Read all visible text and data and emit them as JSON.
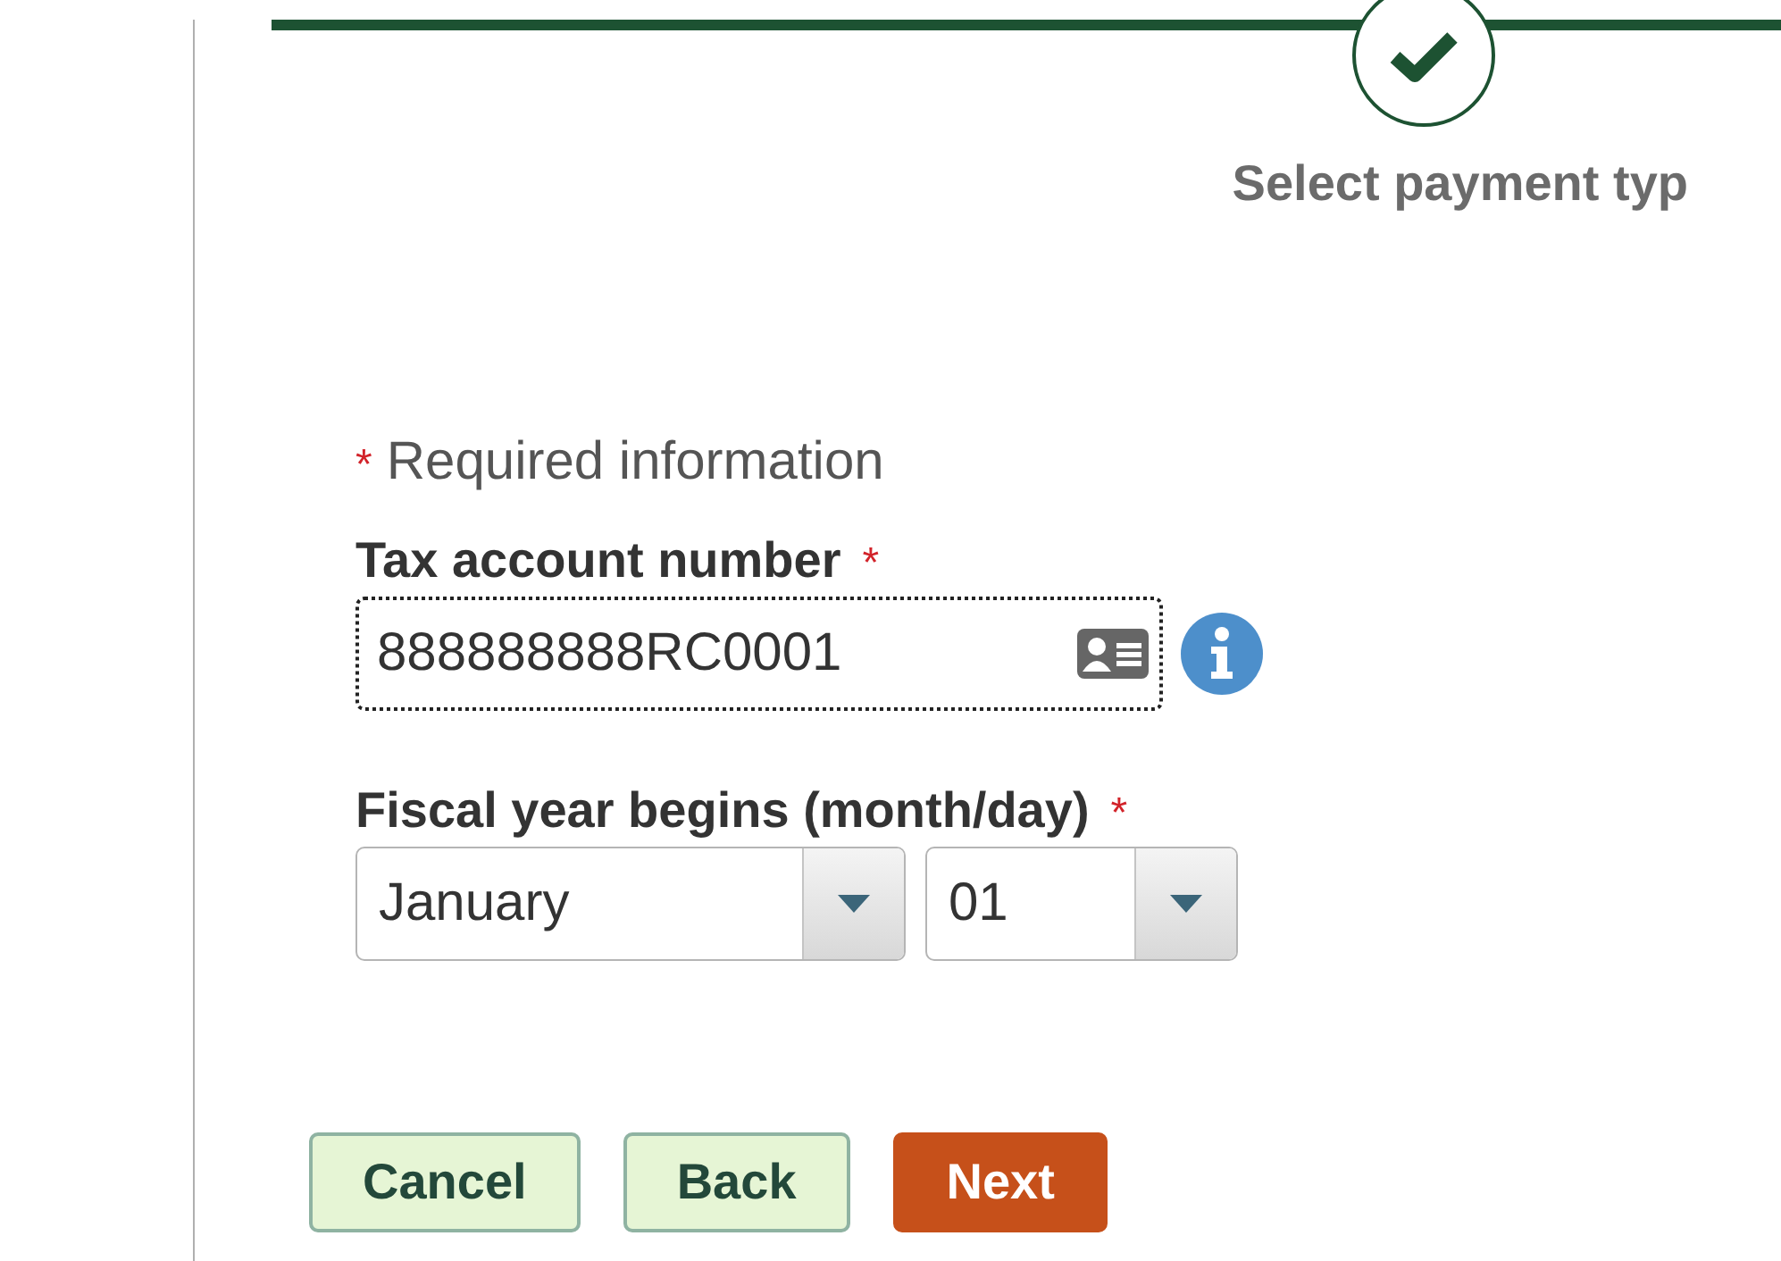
{
  "progress": {
    "step_label": "Select payment typ",
    "completed": true
  },
  "required_note": {
    "marker": "*",
    "text": "Required information"
  },
  "tax_account": {
    "label": "Tax account number",
    "required": true,
    "value": "888888888RC0001"
  },
  "fiscal_year": {
    "label": "Fiscal year begins (month/day)",
    "required": true,
    "month": "January",
    "day": "01"
  },
  "buttons": [
    {
      "label": "Cancel",
      "kind": "secondary"
    },
    {
      "label": "Back",
      "kind": "secondary"
    },
    {
      "label": "Next",
      "kind": "primary"
    }
  ]
}
